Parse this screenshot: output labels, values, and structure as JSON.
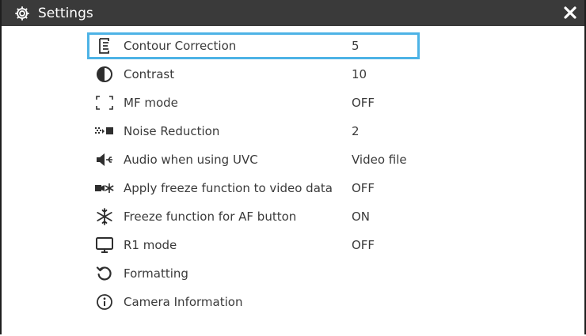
{
  "window": {
    "title": "Settings",
    "title_icon": "gear-icon",
    "close_icon": "close-icon",
    "title_bar_color": "#3a3a3a",
    "selection_color": "#4db3e6"
  },
  "menu": {
    "items": [
      {
        "label": "Contour Correction",
        "value": "5",
        "icon": "contour-correction-icon",
        "selected": true
      },
      {
        "label": "Contrast",
        "value": "10",
        "icon": "contrast-icon"
      },
      {
        "label": "MF mode",
        "value": "OFF",
        "icon": "mf-mode-icon"
      },
      {
        "label": "Noise Reduction",
        "value": "2",
        "icon": "noise-reduction-icon"
      },
      {
        "label": "Audio when using UVC",
        "value": "Video file",
        "icon": "usb-audio-icon"
      },
      {
        "label": "Apply freeze function to video data",
        "value": "OFF",
        "icon": "freeze-video-icon"
      },
      {
        "label": "Freeze function for AF button",
        "value": "ON",
        "icon": "snowflake-icon"
      },
      {
        "label": "R1 mode",
        "value": "OFF",
        "icon": "monitor-icon"
      },
      {
        "label": "Formatting",
        "value": "",
        "icon": "reset-icon"
      },
      {
        "label": "Camera Information",
        "value": "",
        "icon": "info-icon"
      }
    ]
  }
}
